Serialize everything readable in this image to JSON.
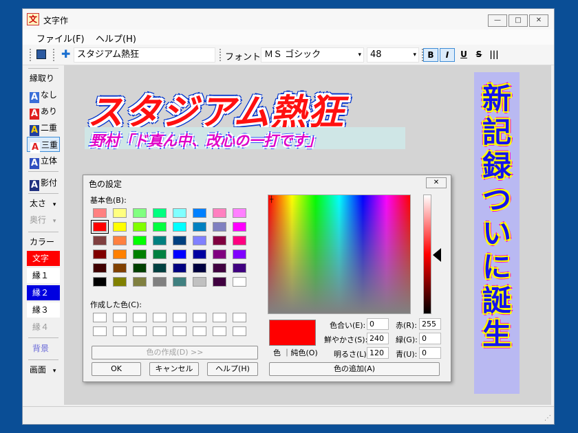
{
  "window": {
    "title": "文字作",
    "app_icon": "文",
    "min": "—",
    "max": "□",
    "close": "✕"
  },
  "menu": [
    "ファイル(F)",
    "ヘルプ(H)"
  ],
  "toolbar": {
    "text_value": "スタジアム熱狂",
    "font_label": "フォント",
    "font_value": "ＭＳ ゴシック",
    "size_value": "48",
    "bold": "B",
    "italic": "I",
    "underline": "U",
    "strike": "S",
    "vertical": "|||",
    "bold_active": true,
    "italic_active": true
  },
  "sidebar": {
    "border_header": "縁取り",
    "border_none": "なし",
    "border_on": "あり",
    "border_double": "二重",
    "border_triple": "三重",
    "border_3d": "立体",
    "shadow": "影付",
    "weight": "太さ",
    "depth": "奥行",
    "color_header": "カラー",
    "color_text": "文字",
    "color_edge1": "縁１",
    "color_edge2": "縁２",
    "color_edge3": "縁３",
    "color_edge4": "縁４",
    "background": "背景",
    "screen": "画面",
    "icon_letter": "A",
    "dd_arrow": "▾"
  },
  "canvas": {
    "main_text": "スタジアム熱狂",
    "sub_text": "野村「ド真ん中、改心の一打です」",
    "vertical_text": [
      "新",
      "記",
      "録",
      "つ",
      "い",
      "に",
      "誕",
      "生"
    ],
    "colors": {
      "canvas_bg": "#d4d4d4",
      "main_fill": "#ff1010",
      "main_edge": "#0033cc",
      "sub_fill": "#e000c8",
      "sub_bg": "#cfe6e6",
      "vert_fill": "#1414ee",
      "vert_bg": "#b9b9f2"
    }
  },
  "dialog": {
    "title": "色の設定",
    "close": "✕",
    "basic_label": "基本色(B):",
    "custom_label": "作成した色(C):",
    "define_button": "色の作成(D) >>",
    "ok": "OK",
    "cancel": "キャンセル",
    "help": "ヘルプ(H)",
    "add_button": "色の追加(A)",
    "color_solid_label": "色 ｜純色(O)",
    "hue_label": "色合い(E):",
    "hue": "0",
    "sat_label": "鮮やかさ(S):",
    "sat": "240",
    "lum_label": "明るさ(L):",
    "lum": "120",
    "red_label": "赤(R):",
    "red": "255",
    "green_label": "緑(G):",
    "green": "0",
    "blue_label": "青(U):",
    "blue": "0",
    "basic_colors": [
      "#ff8080",
      "#ffff80",
      "#80ff80",
      "#00ff80",
      "#80ffff",
      "#0080ff",
      "#ff80c0",
      "#ff80ff",
      "#ff0000",
      "#ffff00",
      "#80ff00",
      "#00ff40",
      "#00ffff",
      "#0080c0",
      "#8080c0",
      "#ff00ff",
      "#804040",
      "#ff8040",
      "#00ff00",
      "#008080",
      "#004080",
      "#8080ff",
      "#800040",
      "#ff0080",
      "#800000",
      "#ff8000",
      "#008000",
      "#008040",
      "#0000ff",
      "#0000a0",
      "#800080",
      "#8000ff",
      "#400000",
      "#804000",
      "#004000",
      "#004040",
      "#000080",
      "#000040",
      "#400040",
      "#400080",
      "#000000",
      "#808000",
      "#808040",
      "#808080",
      "#408080",
      "#c0c0c0",
      "#400040",
      "#ffffff"
    ],
    "selected_index": 8
  }
}
